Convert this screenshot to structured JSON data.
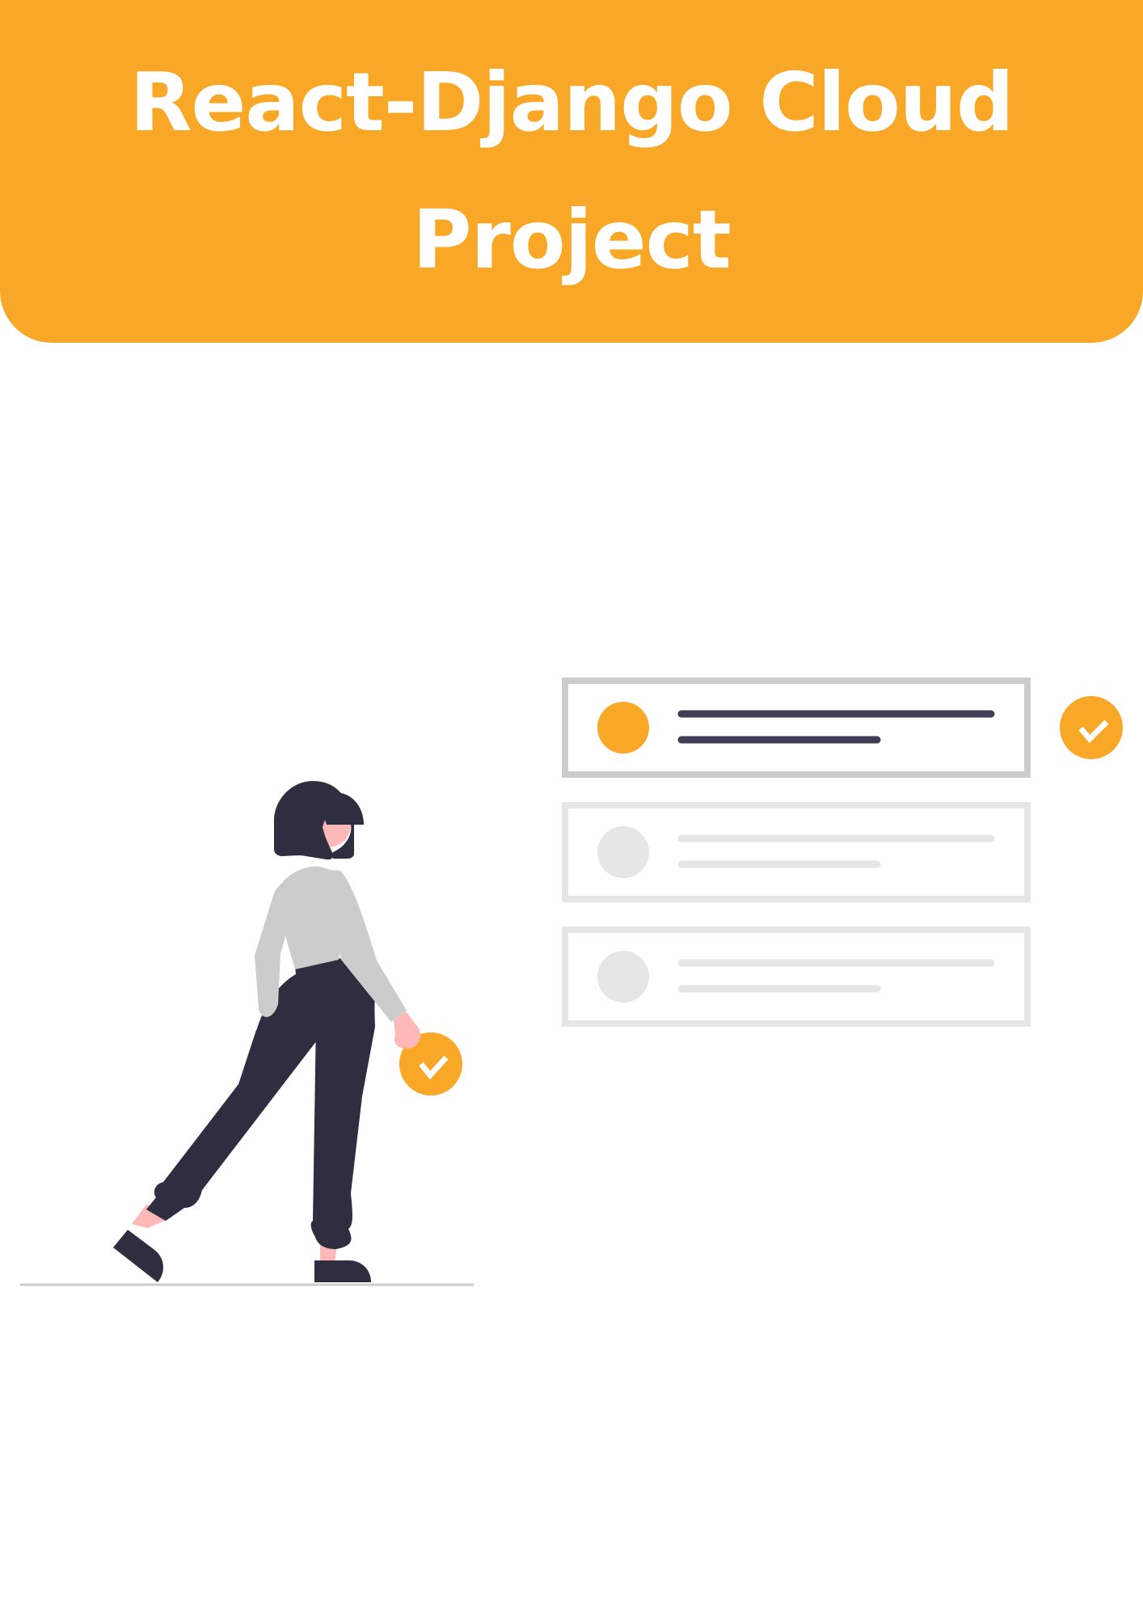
{
  "header": {
    "title": "React-Django Cloud Project"
  },
  "illustration": {
    "accent_color": "#F8A826",
    "dark_color": "#2F2E41",
    "skin_color": "#FFB8B8",
    "shirt_color": "#CCCCCC",
    "card_border_active": "#CCCCCC",
    "card_border_inactive": "#E6E6E6",
    "icons": [
      "check-circle-icon",
      "checkmark-icon"
    ],
    "cards": [
      {
        "state": "active",
        "checked": true
      },
      {
        "state": "inactive",
        "checked": false
      },
      {
        "state": "inactive",
        "checked": false
      }
    ]
  }
}
